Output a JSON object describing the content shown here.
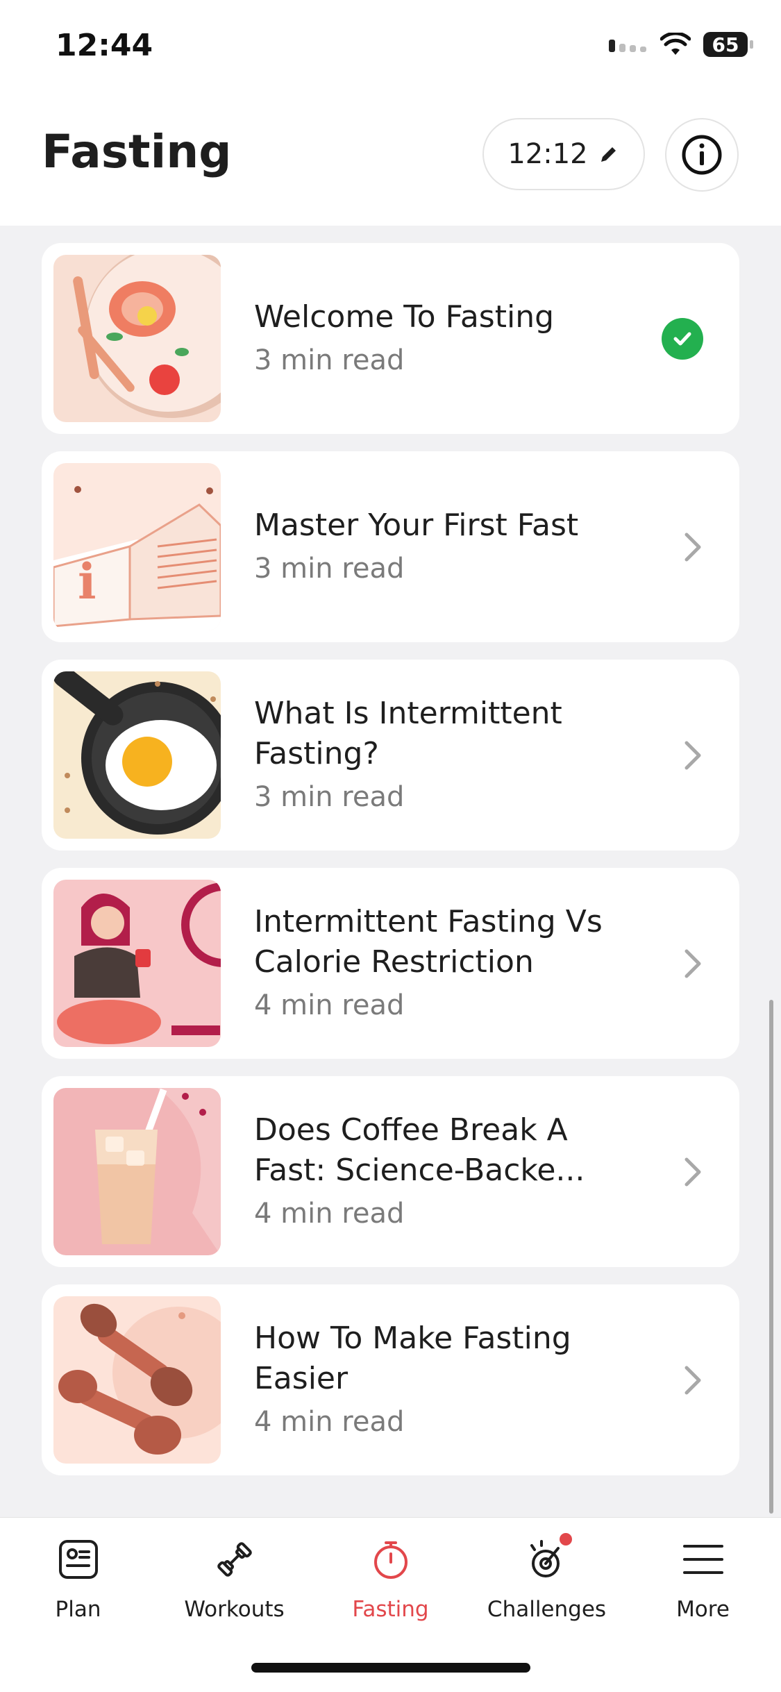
{
  "status_bar": {
    "time": "12:44",
    "battery": "65"
  },
  "header": {
    "title": "Fasting",
    "timer": "12:12"
  },
  "articles": [
    {
      "title": "Welcome To Fasting",
      "subtitle": "3 min read",
      "status": "completed"
    },
    {
      "title": "Master Your First Fast",
      "subtitle": "3 min read",
      "status": "open"
    },
    {
      "title": "What Is Intermittent Fasting?",
      "subtitle": "3 min read",
      "status": "open"
    },
    {
      "title": "Intermittent Fasting Vs Calorie Restriction",
      "subtitle": "4 min read",
      "status": "open"
    },
    {
      "title": "Does Coffee Break A Fast: Science-Backe...",
      "subtitle": "4 min read",
      "status": "open"
    },
    {
      "title": "How To Make Fasting Easier",
      "subtitle": "4 min read",
      "status": "open"
    }
  ],
  "tabs": [
    {
      "label": "Plan",
      "icon": "plan-icon"
    },
    {
      "label": "Workouts",
      "icon": "dumbbell-icon"
    },
    {
      "label": "Fasting",
      "icon": "stopwatch-icon",
      "active": true
    },
    {
      "label": "Challenges",
      "icon": "challenges-icon",
      "badge": true
    },
    {
      "label": "More",
      "icon": "menu-icon"
    }
  ],
  "colors": {
    "accent": "#e2474b",
    "check": "#23b04f"
  }
}
